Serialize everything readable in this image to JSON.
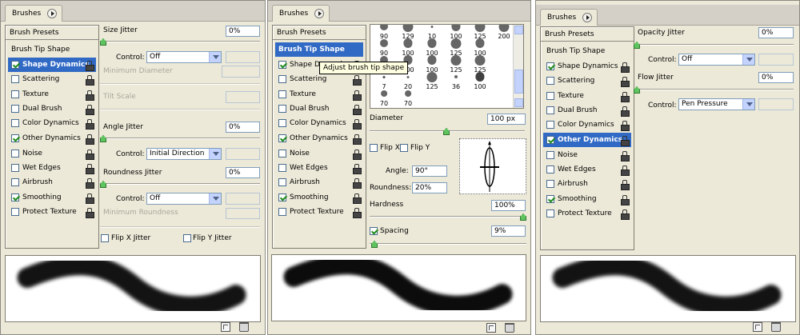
{
  "colors": {
    "selection": "#316ac5",
    "panel_bg": "#ece9d8",
    "slider_thumb": "#5fc45f",
    "checkmark": "#1f8a1f"
  },
  "panels": [
    {
      "tab": "Brushes",
      "presets": "Brush Presets",
      "tip_shape": "Brush Tip Shape",
      "items": [
        {
          "label": "Shape Dynamics",
          "checked": true,
          "selected": true
        },
        {
          "label": "Scattering",
          "checked": false
        },
        {
          "label": "Texture",
          "checked": false
        },
        {
          "label": "Dual Brush",
          "checked": false
        },
        {
          "label": "Color Dynamics",
          "checked": false
        },
        {
          "label": "Other Dynamics",
          "checked": true
        },
        {
          "label": "Noise",
          "checked": false
        },
        {
          "label": "Wet Edges",
          "checked": false
        },
        {
          "label": "Airbrush",
          "checked": false
        },
        {
          "label": "Smoothing",
          "checked": true
        },
        {
          "label": "Protect Texture",
          "checked": false
        }
      ],
      "size_jitter": {
        "label": "Size Jitter",
        "value": "0%"
      },
      "size_control": {
        "label": "Control:",
        "value": "Off"
      },
      "min_diameter": "Minimum Diameter",
      "tilt_scale": "Tilt Scale",
      "angle_jitter": {
        "label": "Angle Jitter",
        "value": "0%"
      },
      "angle_control": {
        "label": "Control:",
        "value": "Initial Direction"
      },
      "roundness_jitter": {
        "label": "Roundness Jitter",
        "value": "0%"
      },
      "roundness_control": {
        "label": "Control:",
        "value": "Off"
      },
      "min_roundness": "Minimum Roundness",
      "flip_x": "Flip X Jitter",
      "flip_y": "Flip Y Jitter"
    },
    {
      "tab": "Brushes",
      "presets": "Brush Presets",
      "tip_shape": "Brush Tip Shape",
      "items": [
        {
          "label": "Shape Dynamics",
          "checked": true
        },
        {
          "label": "Scattering",
          "checked": false
        },
        {
          "label": "Texture",
          "checked": false
        },
        {
          "label": "Dual Brush",
          "checked": false
        },
        {
          "label": "Color Dynamics",
          "checked": false
        },
        {
          "label": "Other Dynamics",
          "checked": true
        },
        {
          "label": "Noise",
          "checked": false
        },
        {
          "label": "Wet Edges",
          "checked": false
        },
        {
          "label": "Airbrush",
          "checked": false
        },
        {
          "label": "Smoothing",
          "checked": true
        },
        {
          "label": "Protect Texture",
          "checked": false
        }
      ],
      "tooltip": "Adjust brush tip shape",
      "brush_sizes": [
        "90",
        "129",
        "10",
        "100",
        "125",
        "200",
        "90",
        "100",
        "100",
        "125",
        "100",
        "",
        "90",
        "100",
        "100",
        "125",
        "125",
        "",
        "7",
        "20",
        "125",
        "36",
        "100",
        "",
        "70",
        "70",
        "",
        "",
        "",
        ""
      ],
      "diameter": {
        "label": "Diameter",
        "value": "100 px"
      },
      "flip_x": "Flip X",
      "flip_y": "Flip Y",
      "angle": {
        "label": "Angle:",
        "value": "90°"
      },
      "roundness": {
        "label": "Roundness:",
        "value": "20%"
      },
      "hardness": {
        "label": "Hardness",
        "value": "100%"
      },
      "spacing": {
        "label": "Spacing",
        "value": "9%"
      }
    },
    {
      "tab": "Brushes",
      "presets": "Brush Presets",
      "tip_shape": "Brush Tip Shape",
      "items": [
        {
          "label": "Shape Dynamics",
          "checked": true
        },
        {
          "label": "Scattering",
          "checked": false
        },
        {
          "label": "Texture",
          "checked": false
        },
        {
          "label": "Dual Brush",
          "checked": false
        },
        {
          "label": "Color Dynamics",
          "checked": false
        },
        {
          "label": "Other Dynamics",
          "checked": true,
          "selected": true
        },
        {
          "label": "Noise",
          "checked": false
        },
        {
          "label": "Wet Edges",
          "checked": false
        },
        {
          "label": "Airbrush",
          "checked": false
        },
        {
          "label": "Smoothing",
          "checked": true
        },
        {
          "label": "Protect Texture",
          "checked": false
        }
      ],
      "opacity_jitter": {
        "label": "Opacity Jitter",
        "value": "0%"
      },
      "opacity_control": {
        "label": "Control:",
        "value": "Off"
      },
      "flow_jitter": {
        "label": "Flow Jitter",
        "value": "0%"
      },
      "flow_control": {
        "label": "Control:",
        "value": "Pen Pressure"
      }
    }
  ]
}
